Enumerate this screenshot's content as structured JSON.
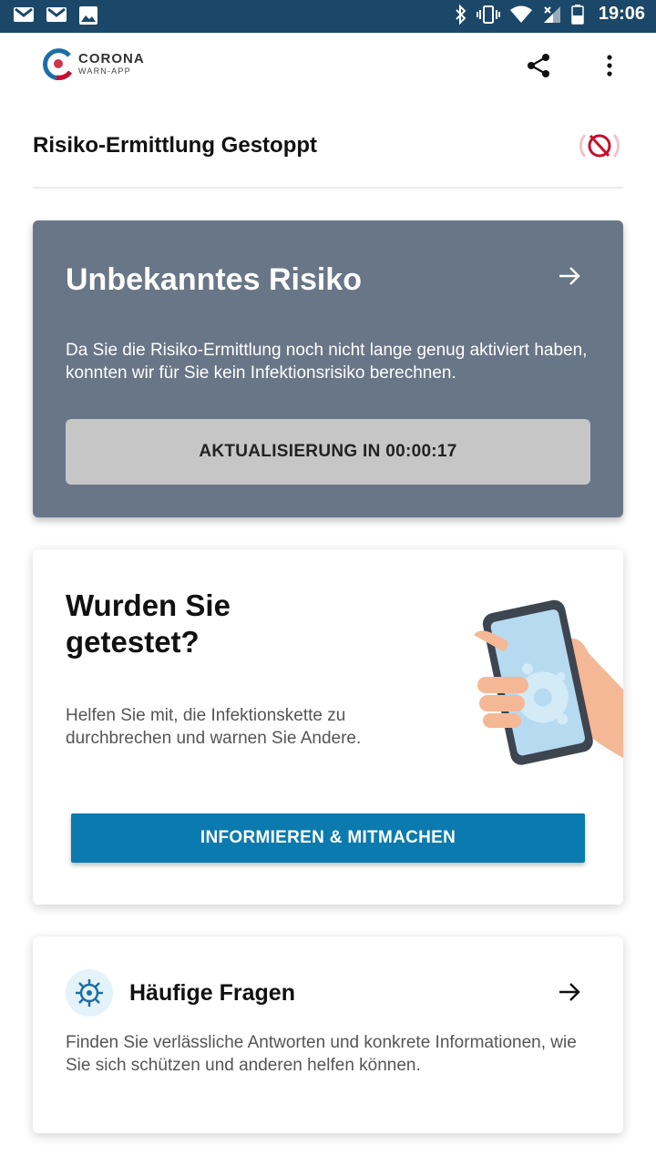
{
  "status_bar": {
    "time": "19:06",
    "left_icons": [
      "gmail-icon",
      "gmail-icon",
      "image-icon"
    ],
    "right_icons": [
      "bluetooth-icon",
      "vibrate-icon",
      "wifi-icon",
      "signal-icon",
      "battery-icon"
    ]
  },
  "app_bar": {
    "logo_line1": "CORONA",
    "logo_line2": "WARN-APP",
    "share_icon": "share-icon",
    "menu_icon": "more-vert-icon"
  },
  "status": {
    "title": "Risiko-Ermittlung Gestoppt",
    "icon": "tracing-stopped-icon",
    "icon_color": "#c8102e"
  },
  "risk_card": {
    "title": "Unbekanntes Risiko",
    "description": "Da Sie die Risiko-Ermittlung noch nicht lange genug aktiviert haben, konnten wir für Sie kein Infektionsrisiko berechnen.",
    "button_label": "AKTUALISIERUNG IN 00:00:17",
    "background_color": "#687687"
  },
  "test_card": {
    "title": "Wurden Sie getestet?",
    "description": "Helfen Sie mit, die Infektionskette zu durchbrechen und warnen Sie Andere.",
    "button_label": "INFORMIEREN & MITMACHEN",
    "button_color": "#0b7aae",
    "illustration": "hand-holding-phone-illustration"
  },
  "faq_card": {
    "title": "Häufige Fragen",
    "description": "Finden Sie verlässliche Antworten und konkrete Informationen, wie Sie sich schützen und anderen helfen können.",
    "icon": "virus-icon"
  }
}
